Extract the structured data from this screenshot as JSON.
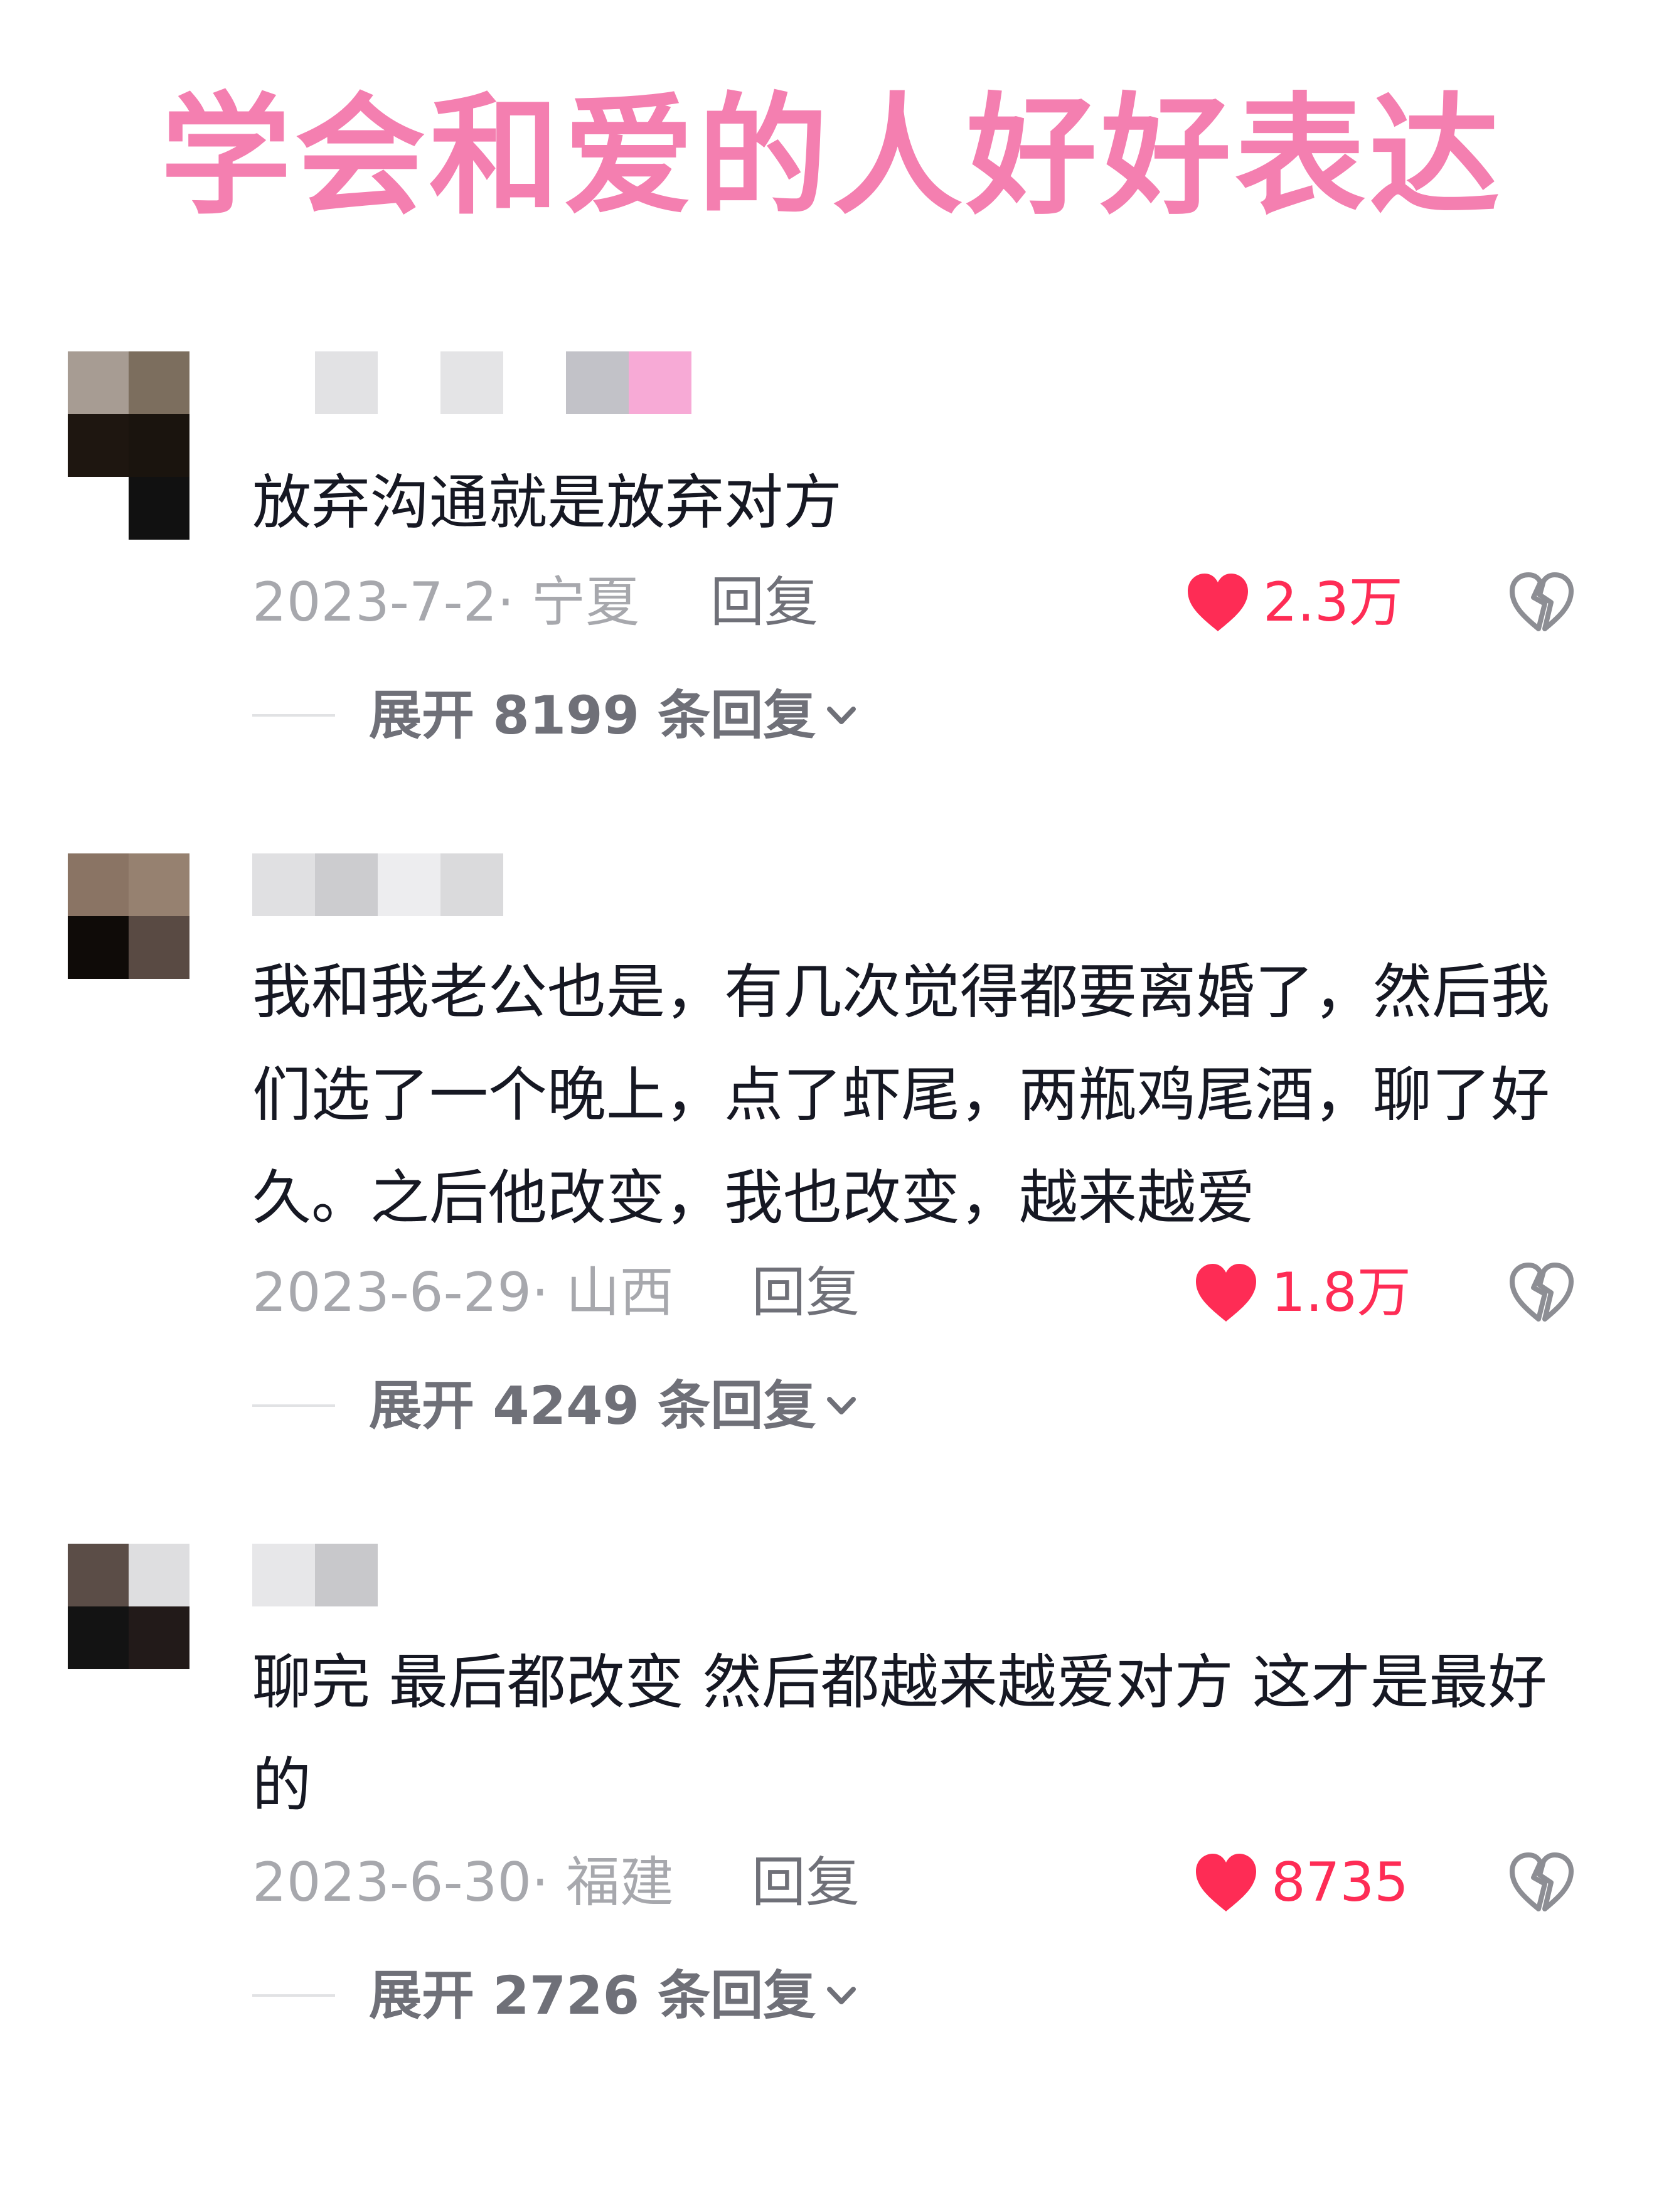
{
  "title": "学会和爱的人好好表达",
  "reply_label": "回复",
  "accent_color": "#f47fb0",
  "like_color": "#fe2c55",
  "comments": [
    {
      "text": "放弃沟通就是放弃对方",
      "meta": "2023-7-2· 宁夏",
      "likes": "2.3万",
      "expand": "展开 8199 条回复"
    },
    {
      "text": "我和我老公也是，有几次觉得都要离婚了，然后我们选了一个晚上，点了虾尾，两瓶鸡尾酒，聊了好久。之后他改变，我也改变，越来越爱",
      "meta": "2023-6-29· 山西",
      "likes": "1.8万",
      "expand": "展开 4249 条回复"
    },
    {
      "text": "聊完 最后都改变 然后都越来越爱对方 这才是最好的",
      "meta": "2023-6-30· 福建",
      "likes": "8735",
      "expand": "展开 2726 条回复"
    }
  ],
  "icons": {
    "like": "heart-filled-icon",
    "dislike": "broken-heart-icon",
    "expand": "chevron-down-icon"
  }
}
